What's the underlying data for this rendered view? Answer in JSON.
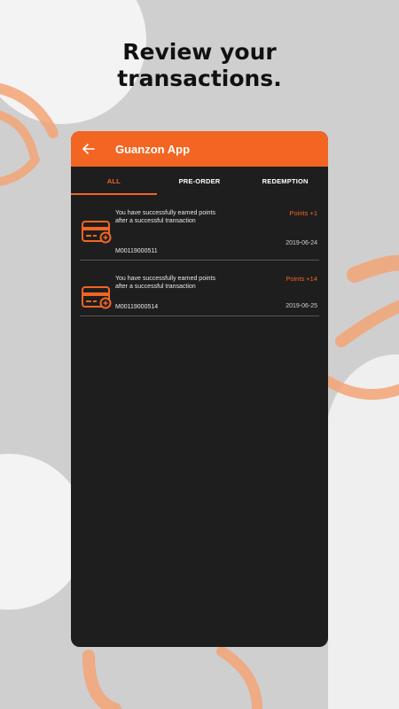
{
  "headline": {
    "line1": "Review your",
    "line2": "transactions."
  },
  "colors": {
    "accent": "#f26522",
    "panel": "#1e1e1e",
    "background": "#cfcfcf"
  },
  "appbar": {
    "title": "Guanzon App",
    "back_icon": "arrow-left-icon"
  },
  "tabs": [
    {
      "label": "ALL",
      "active": true
    },
    {
      "label": "PRE-ORDER",
      "active": false
    },
    {
      "label": "REDEMPTION",
      "active": false
    }
  ],
  "transactions": [
    {
      "icon": "credit-card-icon",
      "description": "You have successfully earned points after a successful transaction",
      "points": "Points +1",
      "date": "2019-06-24",
      "reference": "M00119000511"
    },
    {
      "icon": "credit-card-icon",
      "description": "You have successfully earned points after a successful transaction",
      "points": "Points +14",
      "date": "2019-06-25",
      "reference": "M00119000514"
    }
  ]
}
